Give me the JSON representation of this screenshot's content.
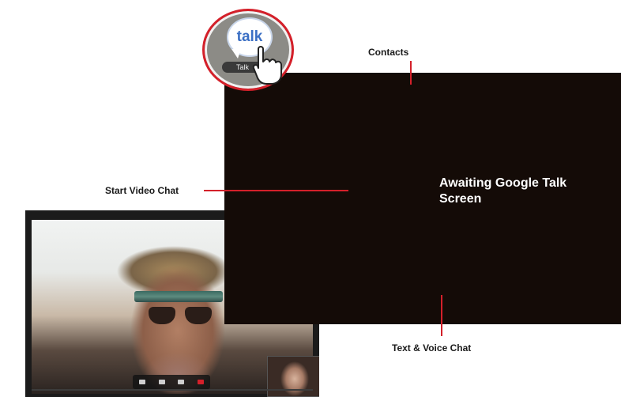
{
  "app_icon": {
    "glyph": "talk",
    "label": "Talk",
    "icon": "google-talk-icon"
  },
  "screen": {
    "status_text": "Awaiting Google Talk Screen"
  },
  "callouts": {
    "contacts": "Contacts",
    "start_video_chat": "Start Video Chat",
    "text_voice_chat": "Text & Voice Chat"
  },
  "colors": {
    "accent": "#d4202a",
    "screen_bg": "#140b07",
    "talk_blue": "#3b6fc4"
  }
}
